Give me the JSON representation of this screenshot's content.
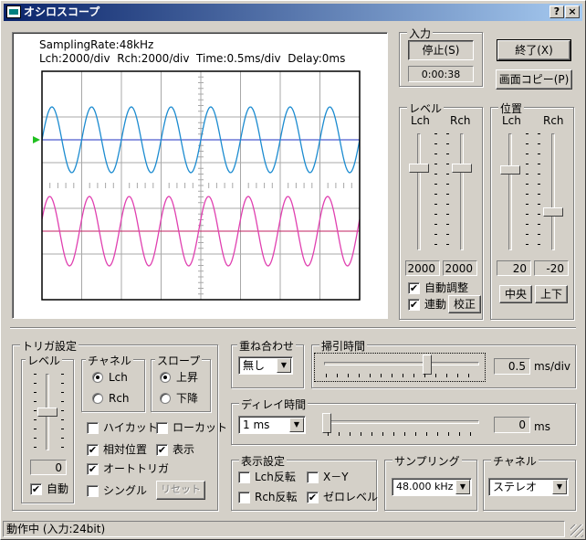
{
  "window": {
    "title": "オシロスコープ",
    "help": "?",
    "close": "×"
  },
  "scope": {
    "line1": "SamplingRate:48kHz",
    "line2": "Lch:2000/div  Rch:2000/div  Time:0.5ms/div  Delay:0ms",
    "colors": {
      "lch": "#1b8bd0",
      "rch": "#e040b0",
      "grid": "#a8a8a8",
      "trigger": "#20c020"
    }
  },
  "input": {
    "group": "入力",
    "stop_label": "停止(S)",
    "elapsed": "0:00:38"
  },
  "actions": {
    "exit_label": "終了(X)",
    "copy_label": "画面コピー(P)"
  },
  "level": {
    "group": "レベル",
    "lch_label": "Lch",
    "rch_label": "Rch",
    "lch_value": "2000",
    "rch_value": "2000",
    "auto_label": "自動調整",
    "auto_checked": true,
    "link_label": "連動",
    "link_checked": true,
    "calibrate_label": "校正"
  },
  "position": {
    "group": "位置",
    "lch_label": "Lch",
    "rch_label": "Rch",
    "lch_value": "20",
    "rch_value": "-20",
    "center_label": "中央",
    "down_label": "上下"
  },
  "trigger": {
    "group": "トリガ設定",
    "level_group": "レベル",
    "level_value": "0",
    "auto_label": "自動",
    "auto_checked": true,
    "channel_group": "チャネル",
    "ch_lch": "Lch",
    "ch_rch": "Rch",
    "channel_selected": "Lch",
    "slope_group": "スロープ",
    "slope_up": "上昇",
    "slope_down": "下降",
    "slope_selected": "上昇",
    "highcut": "ハイカット",
    "lowcut": "ローカット",
    "relative": "相対位置",
    "show": "表示",
    "autotrigger": "オートトリガ",
    "single": "シングル",
    "reset": "リセット",
    "checks": {
      "highcut": false,
      "lowcut": false,
      "relative": true,
      "show": true,
      "autotrigger": true,
      "single": false
    }
  },
  "overlay": {
    "group": "重ね合わせ",
    "value": "無し"
  },
  "sweep": {
    "group": "掃引時間",
    "value": "0.5",
    "unit": "ms/div"
  },
  "delay": {
    "group": "ディレイ時間",
    "value": "0",
    "unit": "ms",
    "range": "1 ms"
  },
  "display": {
    "group": "表示設定",
    "lch_invert": "Lch反転",
    "xy": "X－Y",
    "rch_invert": "Rch反転",
    "zero_level": "ゼロレベル",
    "checks": {
      "lch_invert": false,
      "xy": false,
      "rch_invert": false,
      "zero_level": true
    }
  },
  "sampling": {
    "group": "サンプリング",
    "value": "48.000 kHz"
  },
  "channel": {
    "group": "チャネル",
    "value": "ステレオ"
  },
  "status": {
    "text": "動作中 (入力:24bit)"
  }
}
